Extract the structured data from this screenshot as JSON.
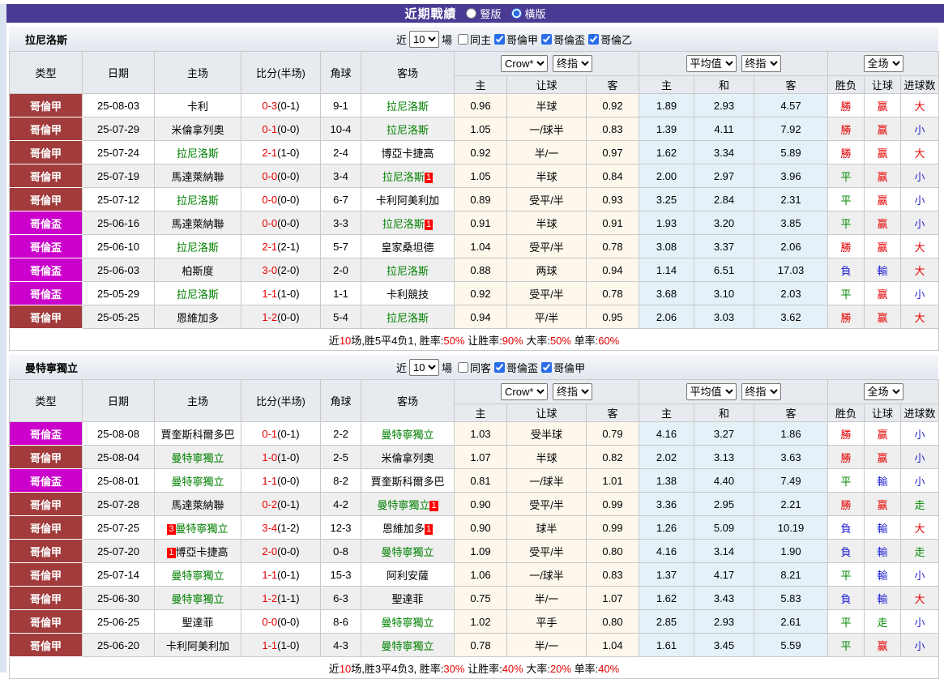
{
  "page": {
    "title": "近期戰績",
    "view_vertical": "豎版",
    "view_horizontal": "橫版"
  },
  "controls": {
    "near": "近",
    "games_suffix": "場"
  },
  "table_head": {
    "type": "类型",
    "date": "日期",
    "home": "主场",
    "score": "比分(半场)",
    "corner": "角球",
    "away": "客场",
    "h": "主",
    "handicap": "让球",
    "a": "客",
    "avg_h": "主",
    "avg_d": "和",
    "avg_a": "客",
    "result": "胜负",
    "result_handicap": "让球",
    "result_goals": "进球数",
    "sel_crow": "Crow*",
    "sel_final1": "终指",
    "sel_avg": "平均值",
    "sel_final2": "终指",
    "sel_scope": "全场"
  },
  "sections": [
    {
      "team": "拉尼洛斯",
      "games": "10",
      "filters": [
        {
          "label": "同主",
          "checked": false
        },
        {
          "label": "哥倫甲",
          "checked": true
        },
        {
          "label": "哥倫盃",
          "checked": true
        },
        {
          "label": "哥倫乙",
          "checked": true
        }
      ],
      "rows": [
        {
          "lg": "哥倫甲",
          "lc": "jia",
          "d": "25-08-03",
          "h": "卡利",
          "hf": false,
          "hc": "",
          "s": "0-3",
          "sh": "(0-1)",
          "cn": "9-1",
          "a": "拉尼洛斯",
          "af": true,
          "ac": "",
          "o": [
            "0.96",
            "半球",
            "0.92"
          ],
          "v": [
            "1.89",
            "2.93",
            "4.57"
          ],
          "r": [
            "勝",
            "赢",
            "大"
          ]
        },
        {
          "lg": "哥倫甲",
          "lc": "jia",
          "d": "25-07-29",
          "h": "米倫拿列奧",
          "hf": false,
          "hc": "",
          "s": "0-1",
          "sh": "(0-0)",
          "cn": "10-4",
          "a": "拉尼洛斯",
          "af": true,
          "ac": "",
          "o": [
            "1.05",
            "一/球半",
            "0.83"
          ],
          "v": [
            "1.39",
            "4.11",
            "7.92"
          ],
          "r": [
            "勝",
            "赢",
            "小"
          ]
        },
        {
          "lg": "哥倫甲",
          "lc": "jia",
          "d": "25-07-24",
          "h": "拉尼洛斯",
          "hf": true,
          "hc": "",
          "s": "2-1",
          "sh": "(1-0)",
          "cn": "2-4",
          "a": "博亞卡捷高",
          "af": false,
          "ac": "",
          "o": [
            "0.92",
            "半/一",
            "0.97"
          ],
          "v": [
            "1.62",
            "3.34",
            "5.89"
          ],
          "r": [
            "勝",
            "赢",
            "大"
          ]
        },
        {
          "lg": "哥倫甲",
          "lc": "jia",
          "d": "25-07-19",
          "h": "馬達萊納聯",
          "hf": false,
          "hc": "",
          "s": "0-0",
          "sh": "(0-0)",
          "cn": "3-4",
          "a": "拉尼洛斯",
          "af": true,
          "ac": "1",
          "o": [
            "1.05",
            "半球",
            "0.84"
          ],
          "v": [
            "2.00",
            "2.97",
            "3.96"
          ],
          "r": [
            "平",
            "赢",
            "小"
          ]
        },
        {
          "lg": "哥倫甲",
          "lc": "jia",
          "d": "25-07-12",
          "h": "拉尼洛斯",
          "hf": true,
          "hc": "",
          "s": "0-0",
          "sh": "(0-0)",
          "cn": "6-7",
          "a": "卡利阿美利加",
          "af": false,
          "ac": "",
          "o": [
            "0.89",
            "受平/半",
            "0.93"
          ],
          "v": [
            "3.25",
            "2.84",
            "2.31"
          ],
          "r": [
            "平",
            "赢",
            "小"
          ]
        },
        {
          "lg": "哥倫盃",
          "lc": "bei",
          "d": "25-06-16",
          "h": "馬達萊納聯",
          "hf": false,
          "hc": "",
          "s": "0-0",
          "sh": "(0-0)",
          "cn": "3-3",
          "a": "拉尼洛斯",
          "af": true,
          "ac": "1",
          "o": [
            "0.91",
            "半球",
            "0.91"
          ],
          "v": [
            "1.93",
            "3.20",
            "3.85"
          ],
          "r": [
            "平",
            "赢",
            "小"
          ]
        },
        {
          "lg": "哥倫盃",
          "lc": "bei",
          "d": "25-06-10",
          "h": "拉尼洛斯",
          "hf": true,
          "hc": "",
          "s": "2-1",
          "sh": "(2-1)",
          "cn": "5-7",
          "a": "皇家桑坦德",
          "af": false,
          "ac": "",
          "o": [
            "1.04",
            "受平/半",
            "0.78"
          ],
          "v": [
            "3.08",
            "3.37",
            "2.06"
          ],
          "r": [
            "勝",
            "赢",
            "大"
          ]
        },
        {
          "lg": "哥倫盃",
          "lc": "bei",
          "d": "25-06-03",
          "h": "柏斯度",
          "hf": false,
          "hc": "",
          "s": "3-0",
          "sh": "(2-0)",
          "cn": "2-0",
          "a": "拉尼洛斯",
          "af": true,
          "ac": "",
          "o": [
            "0.88",
            "两球",
            "0.94"
          ],
          "v": [
            "1.14",
            "6.51",
            "17.03"
          ],
          "r": [
            "負",
            "輸",
            "大"
          ]
        },
        {
          "lg": "哥倫盃",
          "lc": "bei",
          "d": "25-05-29",
          "h": "拉尼洛斯",
          "hf": true,
          "hc": "",
          "s": "1-1",
          "sh": "(1-0)",
          "cn": "1-1",
          "a": "卡利競技",
          "af": false,
          "ac": "",
          "o": [
            "0.92",
            "受平/半",
            "0.78"
          ],
          "v": [
            "3.68",
            "3.10",
            "2.03"
          ],
          "r": [
            "平",
            "赢",
            "小"
          ]
        },
        {
          "lg": "哥倫甲",
          "lc": "jia",
          "d": "25-05-25",
          "h": "恩維加多",
          "hf": false,
          "hc": "",
          "s": "1-2",
          "sh": "(0-0)",
          "cn": "5-4",
          "a": "拉尼洛斯",
          "af": true,
          "ac": "",
          "o": [
            "0.94",
            "平/半",
            "0.95"
          ],
          "v": [
            "2.06",
            "3.03",
            "3.62"
          ],
          "r": [
            "勝",
            "赢",
            "大"
          ]
        }
      ],
      "summary": [
        {
          "t": "近"
        },
        {
          "t": "10",
          "r": true
        },
        {
          "t": "场,胜5平4负1, 胜率:"
        },
        {
          "t": "50%",
          "r": true
        },
        {
          "t": " 让胜率:"
        },
        {
          "t": "90%",
          "r": true
        },
        {
          "t": " 大率:"
        },
        {
          "t": "50%",
          "r": true
        },
        {
          "t": " 单率:"
        },
        {
          "t": "60%",
          "r": true
        }
      ]
    },
    {
      "team": "曼特寧獨立",
      "games": "10",
      "filters": [
        {
          "label": "同客",
          "checked": false
        },
        {
          "label": "哥倫盃",
          "checked": true
        },
        {
          "label": "哥倫甲",
          "checked": true
        }
      ],
      "rows": [
        {
          "lg": "哥倫盃",
          "lc": "bei",
          "d": "25-08-08",
          "h": "賈奎斯科爾多巴",
          "hf": false,
          "hc": "",
          "s": "0-1",
          "sh": "(0-1)",
          "cn": "2-2",
          "a": "曼特寧獨立",
          "af": true,
          "ac": "",
          "o": [
            "1.03",
            "受半球",
            "0.79"
          ],
          "v": [
            "4.16",
            "3.27",
            "1.86"
          ],
          "r": [
            "勝",
            "赢",
            "小"
          ]
        },
        {
          "lg": "哥倫甲",
          "lc": "jia",
          "d": "25-08-04",
          "h": "曼特寧獨立",
          "hf": true,
          "hc": "",
          "s": "1-0",
          "sh": "(1-0)",
          "cn": "2-5",
          "a": "米倫拿列奧",
          "af": false,
          "ac": "",
          "o": [
            "1.07",
            "半球",
            "0.82"
          ],
          "v": [
            "2.02",
            "3.13",
            "3.63"
          ],
          "r": [
            "勝",
            "赢",
            "小"
          ]
        },
        {
          "lg": "哥倫盃",
          "lc": "bei",
          "d": "25-08-01",
          "h": "曼特寧獨立",
          "hf": true,
          "hc": "",
          "s": "1-1",
          "sh": "(0-0)",
          "cn": "8-2",
          "a": "賈奎斯科爾多巴",
          "af": false,
          "ac": "",
          "o": [
            "0.81",
            "一/球半",
            "1.01"
          ],
          "v": [
            "1.38",
            "4.40",
            "7.49"
          ],
          "r": [
            "平",
            "輸",
            "小"
          ]
        },
        {
          "lg": "哥倫甲",
          "lc": "jia",
          "d": "25-07-28",
          "h": "馬達萊納聯",
          "hf": false,
          "hc": "",
          "s": "0-2",
          "sh": "(0-1)",
          "cn": "4-2",
          "a": "曼特寧獨立",
          "af": true,
          "ac": "1",
          "o": [
            "0.90",
            "受平/半",
            "0.99"
          ],
          "v": [
            "3.36",
            "2.95",
            "2.21"
          ],
          "r": [
            "勝",
            "赢",
            "走"
          ]
        },
        {
          "lg": "哥倫甲",
          "lc": "jia",
          "d": "25-07-25",
          "h": "曼特寧獨立",
          "hf": true,
          "hc": "3",
          "s": "3-4",
          "sh": "(1-2)",
          "cn": "12-3",
          "a": "恩維加多",
          "af": false,
          "ac": "1",
          "o": [
            "0.90",
            "球半",
            "0.99"
          ],
          "v": [
            "1.26",
            "5.09",
            "10.19"
          ],
          "r": [
            "負",
            "輸",
            "大"
          ]
        },
        {
          "lg": "哥倫甲",
          "lc": "jia",
          "d": "25-07-20",
          "h": "博亞卡捷高",
          "hf": false,
          "hc": "1",
          "s": "2-0",
          "sh": "(0-0)",
          "cn": "0-8",
          "a": "曼特寧獨立",
          "af": true,
          "ac": "",
          "o": [
            "1.09",
            "受平/半",
            "0.80"
          ],
          "v": [
            "4.16",
            "3.14",
            "1.90"
          ],
          "r": [
            "負",
            "輸",
            "走"
          ]
        },
        {
          "lg": "哥倫甲",
          "lc": "jia",
          "d": "25-07-14",
          "h": "曼特寧獨立",
          "hf": true,
          "hc": "",
          "s": "1-1",
          "sh": "(0-1)",
          "cn": "15-3",
          "a": "阿利安薩",
          "af": false,
          "ac": "",
          "o": [
            "1.06",
            "一/球半",
            "0.83"
          ],
          "v": [
            "1.37",
            "4.17",
            "8.21"
          ],
          "r": [
            "平",
            "輸",
            "小"
          ]
        },
        {
          "lg": "哥倫甲",
          "lc": "jia",
          "d": "25-06-30",
          "h": "曼特寧獨立",
          "hf": true,
          "hc": "",
          "s": "1-2",
          "sh": "(1-1)",
          "cn": "6-3",
          "a": "聖達菲",
          "af": false,
          "ac": "",
          "o": [
            "0.75",
            "半/一",
            "1.07"
          ],
          "v": [
            "1.62",
            "3.43",
            "5.83"
          ],
          "r": [
            "負",
            "輸",
            "大"
          ]
        },
        {
          "lg": "哥倫甲",
          "lc": "jia",
          "d": "25-06-25",
          "h": "聖達菲",
          "hf": false,
          "hc": "",
          "s": "0-0",
          "sh": "(0-0)",
          "cn": "8-6",
          "a": "曼特寧獨立",
          "af": true,
          "ac": "",
          "o": [
            "1.02",
            "平手",
            "0.80"
          ],
          "v": [
            "2.85",
            "2.93",
            "2.61"
          ],
          "r": [
            "平",
            "走",
            "小"
          ]
        },
        {
          "lg": "哥倫甲",
          "lc": "jia",
          "d": "25-06-20",
          "h": "卡利阿美利加",
          "hf": false,
          "hc": "",
          "s": "1-1",
          "sh": "(1-0)",
          "cn": "4-3",
          "a": "曼特寧獨立",
          "af": true,
          "ac": "",
          "o": [
            "0.78",
            "半/一",
            "1.04"
          ],
          "v": [
            "1.61",
            "3.45",
            "5.59"
          ],
          "r": [
            "平",
            "赢",
            "小"
          ]
        }
      ],
      "summary": [
        {
          "t": "近"
        },
        {
          "t": "10",
          "r": true
        },
        {
          "t": "场,胜3平4负3, 胜率:"
        },
        {
          "t": "30%",
          "r": true
        },
        {
          "t": " 让胜率:"
        },
        {
          "t": "40%",
          "r": true
        },
        {
          "t": " 大率:"
        },
        {
          "t": "20%",
          "r": true
        },
        {
          "t": " 单率:"
        },
        {
          "t": "40%",
          "r": true
        }
      ]
    }
  ]
}
